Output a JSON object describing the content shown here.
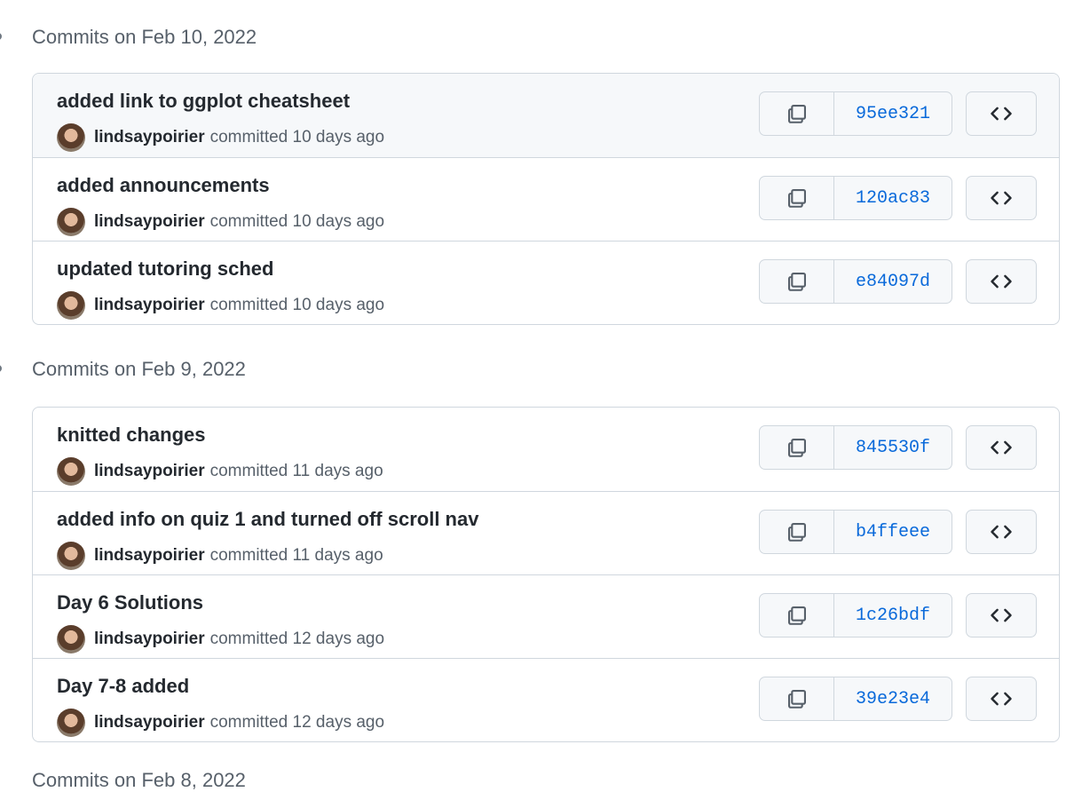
{
  "groups": [
    {
      "title": "Commits on Feb 10, 2022",
      "commits": [
        {
          "message": "added link to ggplot cheatsheet",
          "author": "lindsaypoirier",
          "time": "committed 10 days ago",
          "sha": "95ee321"
        },
        {
          "message": "added announcements",
          "author": "lindsaypoirier",
          "time": "committed 10 days ago",
          "sha": "120ac83"
        },
        {
          "message": "updated tutoring sched",
          "author": "lindsaypoirier",
          "time": "committed 10 days ago",
          "sha": "e84097d"
        }
      ]
    },
    {
      "title": "Commits on Feb 9, 2022",
      "commits": [
        {
          "message": "knitted changes",
          "author": "lindsaypoirier",
          "time": "committed 11 days ago",
          "sha": "845530f"
        },
        {
          "message": "added info on quiz 1 and turned off scroll nav",
          "author": "lindsaypoirier",
          "time": "committed 11 days ago",
          "sha": "b4ffeee"
        },
        {
          "message": "Day 6 Solutions",
          "author": "lindsaypoirier",
          "time": "committed 12 days ago",
          "sha": "1c26bdf"
        },
        {
          "message": "Day 7-8 added",
          "author": "lindsaypoirier",
          "time": "committed 12 days ago",
          "sha": "39e23e4"
        }
      ]
    }
  ],
  "next_group_title": "Commits on Feb 8, 2022",
  "icons": {
    "copy": "copy-icon",
    "browse": "code-icon",
    "timeline": "commit-node-icon"
  }
}
